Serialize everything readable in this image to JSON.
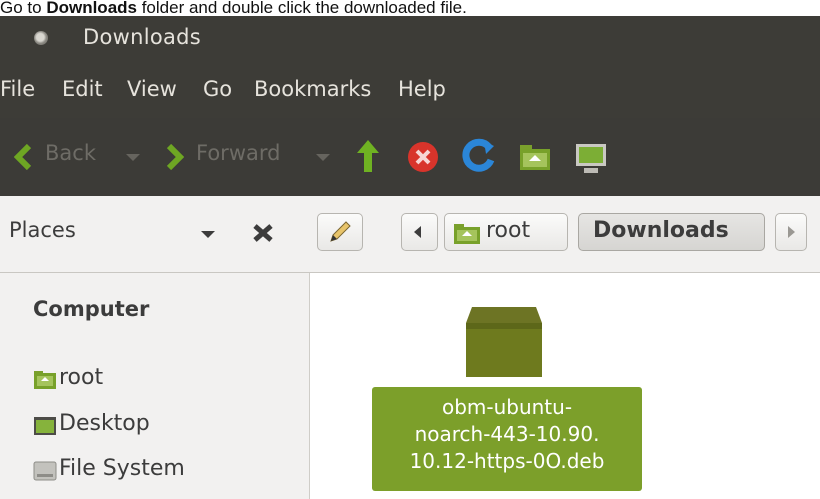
{
  "caption": {
    "prefix": "Go to ",
    "bold": "Downloads",
    "suffix": " folder and double click the downloaded file."
  },
  "window": {
    "title": "Downloads"
  },
  "menu": [
    "File",
    "Edit",
    "View",
    "Go",
    "Bookmarks",
    "Help"
  ],
  "toolbar": {
    "back_label": "Back",
    "forward_label": "Forward",
    "icons": [
      "back-arrow-icon",
      "forward-arrow-icon",
      "up-arrow-icon",
      "stop-icon",
      "reload-icon",
      "home-folder-icon",
      "computer-icon"
    ],
    "colors": {
      "up": "#6fb222",
      "stop": "#d8342b",
      "reload": "#2b86d8",
      "folder": "#78a12a"
    }
  },
  "location": {
    "places_label": "Places",
    "path": [
      "root",
      "Downloads"
    ]
  },
  "sidebar": {
    "heading": "Computer",
    "items": [
      {
        "label": "root",
        "icon": "home-folder-icon"
      },
      {
        "label": "Desktop",
        "icon": "desktop-icon"
      },
      {
        "label": "File System",
        "icon": "drive-icon"
      }
    ]
  },
  "content": {
    "file": {
      "name_lines": [
        "obm-ubuntu-",
        "noarch-443-10.90.",
        "10.12-https-0O.deb"
      ],
      "icon": "package-icon",
      "selection_color": "#7c9f2a"
    }
  }
}
